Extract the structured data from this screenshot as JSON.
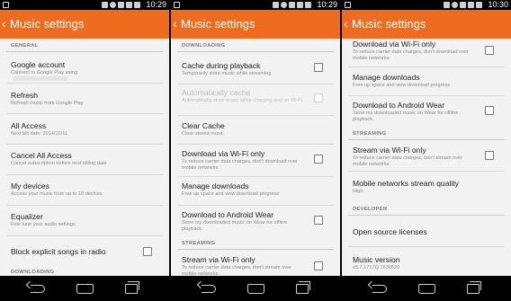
{
  "screens": [
    {
      "status_time": "10:29",
      "title": "Music settings",
      "items": [
        {
          "kind": "header",
          "text": "GENERAL"
        },
        {
          "kind": "item",
          "title": "Google account",
          "subtitle": "Connect to Google Play using",
          "checkbox": false
        },
        {
          "kind": "item",
          "title": "Refresh",
          "subtitle": "Refresh music from Google Play",
          "checkbox": false
        },
        {
          "kind": "item",
          "title": "All Access",
          "subtitle": "Next bill date: 2014/12/11",
          "checkbox": false
        },
        {
          "kind": "item",
          "title": "Cancel All Access",
          "subtitle": "Cancel subscription before next billing date",
          "checkbox": false
        },
        {
          "kind": "item",
          "title": "My devices",
          "subtitle": "Access your music from up to 10 devices",
          "checkbox": false
        },
        {
          "kind": "item",
          "title": "Equalizer",
          "subtitle": "Fine tune your audio settings",
          "checkbox": false
        },
        {
          "kind": "item",
          "title": "Block explicit songs in radio",
          "subtitle": "",
          "checkbox": true
        },
        {
          "kind": "header",
          "text": "DOWNLOADING"
        }
      ]
    },
    {
      "status_time": "10:29",
      "title": "Music settings",
      "items": [
        {
          "kind": "header",
          "text": "DOWNLOADING"
        },
        {
          "kind": "item",
          "title": "Cache during playback",
          "subtitle": "Temporarily store music while streaming",
          "checkbox": true
        },
        {
          "kind": "item",
          "title": "Automatically cache",
          "subtitle": "Automatically store music while charging and on Wi-Fi",
          "checkbox": true,
          "disabled": true
        },
        {
          "kind": "item",
          "title": "Clear Cache",
          "subtitle": "Clear stored music",
          "checkbox": false
        },
        {
          "kind": "item",
          "title": "Download via Wi-Fi only",
          "subtitle": "To reduce carrier data charges, don't download over mobile networks",
          "checkbox": true
        },
        {
          "kind": "item",
          "title": "Manage downloads",
          "subtitle": "Free up space and view download progress",
          "checkbox": false
        },
        {
          "kind": "item",
          "title": "Download to Android Wear",
          "subtitle": "Store my downloaded music on Wear for offline playback.",
          "checkbox": true
        },
        {
          "kind": "header",
          "text": "STREAMING"
        },
        {
          "kind": "item",
          "title": "Stream via Wi-Fi only",
          "subtitle": "To reduce carrier data charges, don't stream over mobile networks",
          "checkbox": true
        }
      ]
    },
    {
      "status_time": "10:30",
      "title": "Music settings",
      "items": [
        {
          "kind": "item",
          "title": "Download via Wi-Fi only",
          "subtitle": "To reduce carrier data charges, don't download over mobile networks",
          "checkbox": true
        },
        {
          "kind": "item",
          "title": "Manage downloads",
          "subtitle": "Free up space and view download progress",
          "checkbox": false
        },
        {
          "kind": "item",
          "title": "Download to Android Wear",
          "subtitle": "Store my downloaded music on Wear for offline playback.",
          "checkbox": true
        },
        {
          "kind": "header",
          "text": "STREAMING"
        },
        {
          "kind": "item",
          "title": "Stream via Wi-Fi only",
          "subtitle": "To reduce carrier data charges, don't stream over mobile networks",
          "checkbox": true
        },
        {
          "kind": "item",
          "title": "Mobile networks stream quality",
          "subtitle": "High",
          "checkbox": false
        },
        {
          "kind": "header",
          "text": "DEVELOPER"
        },
        {
          "kind": "item",
          "title": "Open source licenses",
          "subtitle": "",
          "checkbox": false
        },
        {
          "kind": "item",
          "title": "Music version",
          "subtitle": "v5.7.1717Q.1530520",
          "checkbox": false
        }
      ]
    }
  ],
  "icons": {
    "back": "chevron-left-icon",
    "nav_back": "nav-back-icon",
    "nav_home": "nav-home-icon",
    "nav_recent": "nav-recent-apps-icon"
  },
  "colors": {
    "app_bar": "#ef6c1f",
    "status_bar": "#000000",
    "list_background": "#f2f2f2"
  }
}
